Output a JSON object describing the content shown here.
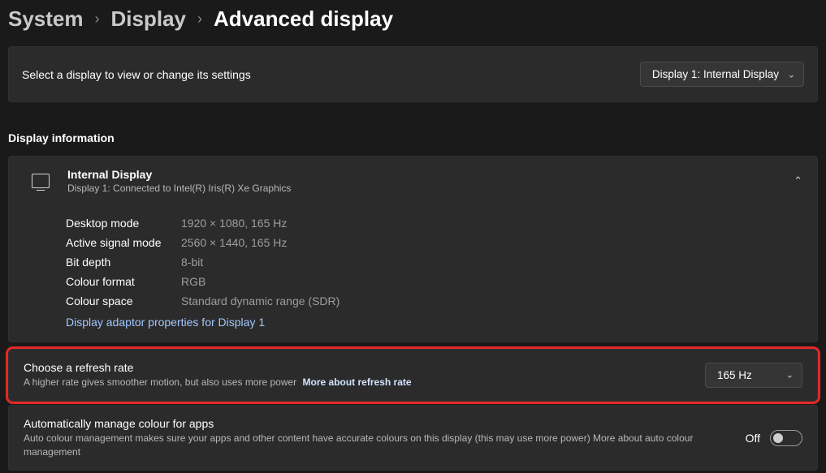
{
  "breadcrumb": {
    "system": "System",
    "display": "Display",
    "advanced": "Advanced display"
  },
  "selector": {
    "label": "Select a display to view or change its settings",
    "value": "Display 1: Internal Display"
  },
  "info_header": "Display information",
  "panel": {
    "title": "Internal Display",
    "subtitle": "Display 1: Connected to Intel(R) Iris(R) Xe Graphics",
    "rows": [
      {
        "label": "Desktop mode",
        "value": "1920 × 1080, 165 Hz"
      },
      {
        "label": "Active signal mode",
        "value": "2560 × 1440, 165 Hz"
      },
      {
        "label": "Bit depth",
        "value": "8-bit"
      },
      {
        "label": "Colour format",
        "value": "RGB"
      },
      {
        "label": "Colour space",
        "value": "Standard dynamic range (SDR)"
      }
    ],
    "adaptor_link": "Display adaptor properties for Display 1"
  },
  "refresh": {
    "title": "Choose a refresh rate",
    "subtitle": "A higher rate gives smoother motion, but also uses more power",
    "more_link": "More about refresh rate",
    "value": "165 Hz"
  },
  "colour": {
    "title": "Automatically manage colour for apps",
    "subtitle": "Auto colour management makes sure your apps and other content have accurate colours on this display (this may use more power) More about auto colour management",
    "toggle_label": "Off",
    "toggle_state": false
  }
}
